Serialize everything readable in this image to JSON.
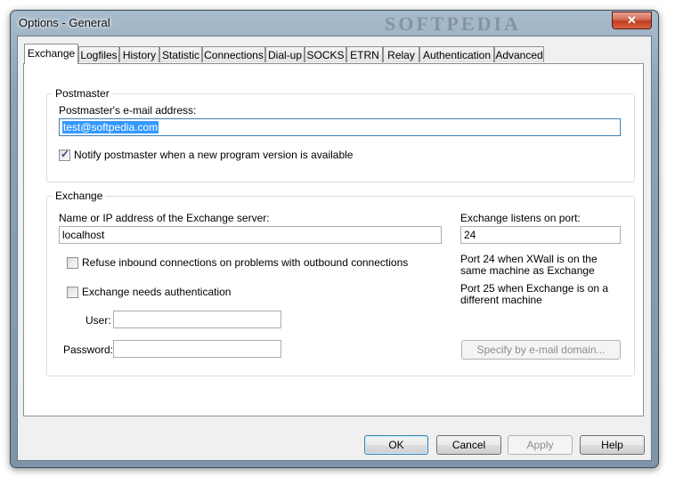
{
  "window": {
    "title": "Options - General",
    "watermark": "SOFTPEDIA",
    "close_glyph": "✕"
  },
  "tabs": [
    "Exchange",
    "Logfiles",
    "History",
    "Statistic",
    "Connections",
    "Dial-up",
    "SOCKS",
    "ETRN",
    "Relay",
    "Authentication",
    "Advanced"
  ],
  "postmaster": {
    "legend": "Postmaster",
    "email_label": "Postmaster's e-mail address:",
    "email_value": "test@softpedia.com",
    "notify_label": "Notify postmaster when a new program version is available",
    "notify_checked": true
  },
  "exchange": {
    "legend": "Exchange",
    "server_label": "Name or IP address of the Exchange server:",
    "server_value": "localhost",
    "port_label": "Exchange listens on port:",
    "port_value": "24",
    "refuse_label": "Refuse inbound connections on problems with outbound connections",
    "refuse_checked": false,
    "auth_label": "Exchange needs authentication",
    "auth_checked": false,
    "user_label": "User:",
    "user_value": "",
    "password_label": "Password:",
    "password_value": "",
    "hint_port24": "Port 24 when XWall is on the same machine as Exchange",
    "hint_port25": "Port 25 when Exchange is on a different machine",
    "specify_button": "Specify by e-mail domain..."
  },
  "buttons": {
    "ok": "OK",
    "cancel": "Cancel",
    "apply": "Apply",
    "help": "Help"
  }
}
